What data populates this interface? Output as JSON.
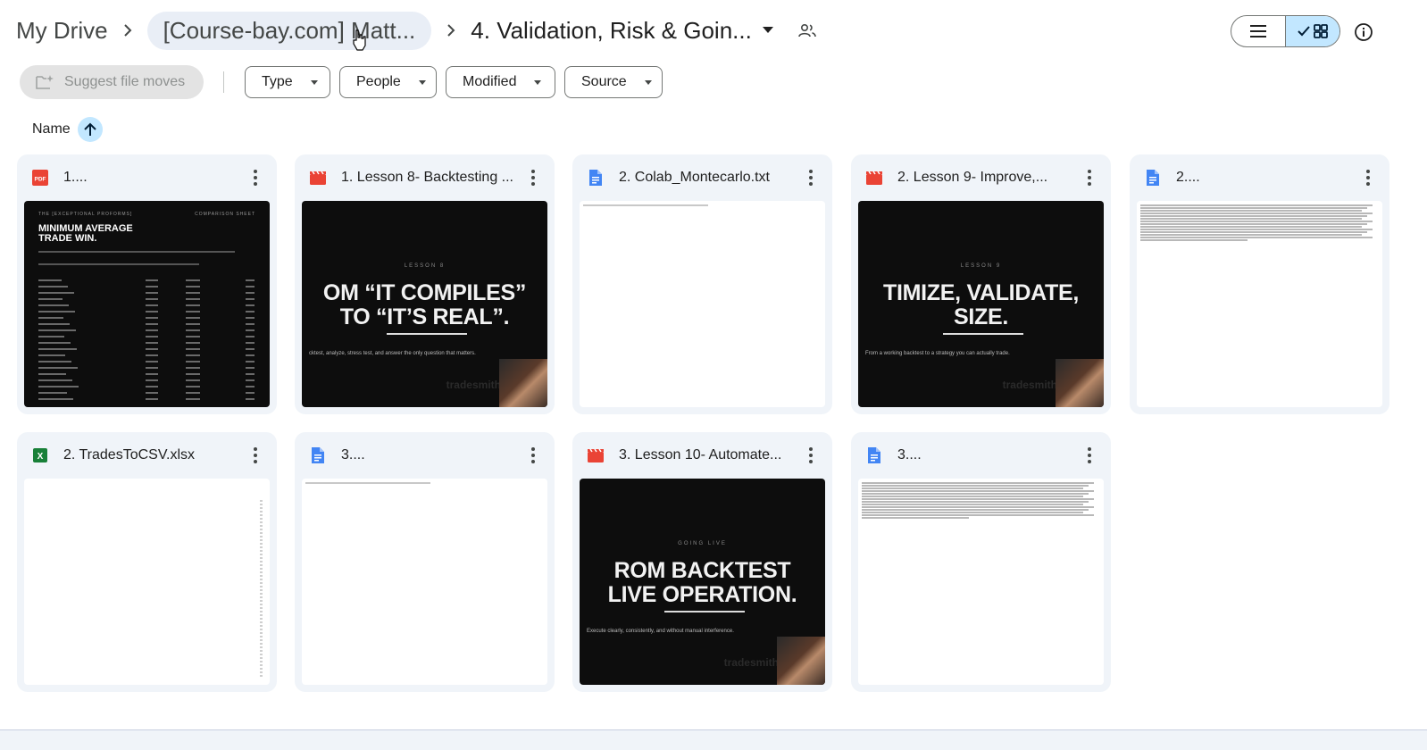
{
  "breadcrumb": {
    "root": "My Drive",
    "parent": "[Course-bay.com] Matt...",
    "current": "4. Validation, Risk & Goin..."
  },
  "toolbar": {
    "suggest_label": "Suggest file moves",
    "filters": [
      "Type",
      "People",
      "Modified",
      "Source"
    ]
  },
  "sort": {
    "label": "Name",
    "direction": "ascending"
  },
  "files": [
    {
      "name": "1....",
      "type": "pdf",
      "thumb": "pdf"
    },
    {
      "name": "1. Lesson 8- Backtesting ...",
      "type": "video",
      "thumb": "slide",
      "slide_kicker": "LESSON 8",
      "slide_title": "OM “IT COMPILES”\nTO “IT’S REAL”.",
      "slide_sub": "cktest, analyze, stress test, and answer the only question that matters."
    },
    {
      "name": "2. Colab_Montecarlo.txt",
      "type": "doc",
      "thumb": "text-sparse"
    },
    {
      "name": "2. Lesson 9- Improve,...",
      "type": "video",
      "thumb": "slide",
      "slide_kicker": "LESSON 9",
      "slide_title": "TIMIZE, VALIDATE,\nSIZE.",
      "slide_sub": "From a working backtest to a strategy you can actually trade."
    },
    {
      "name": "2....",
      "type": "doc",
      "thumb": "text-dense"
    },
    {
      "name": "2. TradesToCSV.xlsx",
      "type": "sheet",
      "thumb": "sheet"
    },
    {
      "name": "3....",
      "type": "doc",
      "thumb": "text-sparse"
    },
    {
      "name": "3. Lesson 10- Automate...",
      "type": "video",
      "thumb": "slide",
      "slide_kicker": "GOING LIVE",
      "slide_title": "ROM BACKTEST\nLIVE OPERATION.",
      "slide_sub": "Execute clearly, consistently, and without manual interference."
    },
    {
      "name": "3....",
      "type": "doc",
      "thumb": "text-dense"
    }
  ],
  "pdf_thumb": {
    "top_left": "THE [EXCEPTIONAL PROFORMS]",
    "top_right": "COMPARISON SHEET",
    "heading": "MINIMUM AVERAGE\nTRADE WIN."
  },
  "watermark": "tradesmith",
  "colors": {
    "accent_bg": "#c2e7ff",
    "card_bg": "#f0f4f9",
    "pdf_red": "#ea4335",
    "doc_blue": "#4285f4",
    "sheet_green": "#188038"
  },
  "icons": {
    "shared": "people-icon",
    "list_view": "list-icon",
    "grid_view": "grid-icon",
    "info": "info-icon",
    "suggest": "move-suggest-icon",
    "sort": "arrow-up-icon"
  }
}
